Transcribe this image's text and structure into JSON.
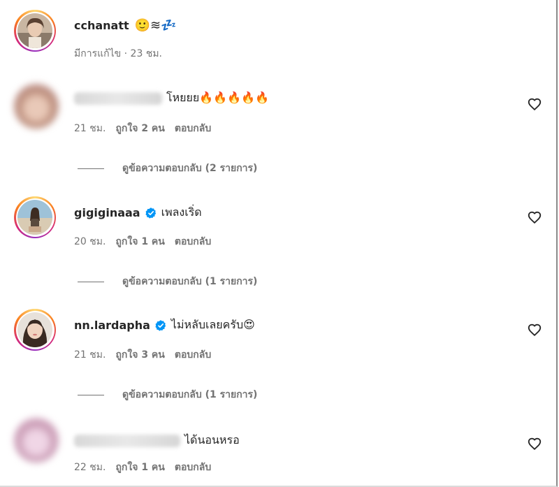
{
  "post": {
    "username": "cchanatt",
    "status_emoji": "🙂≋💤",
    "meta": "มีการแก้ไข · 23 ชม."
  },
  "comments": [
    {
      "username": "",
      "verified": false,
      "text": "โหยยย🔥🔥🔥🔥🔥",
      "time": "21 ชม.",
      "likes": "ถูกใจ 2 คน",
      "reply": "ตอบกลับ",
      "view_replies": "ดูข้อความตอบกลับ (2 รายการ)"
    },
    {
      "username": "gigiginaaa",
      "verified": true,
      "text": "เพลงเริ่ด",
      "time": "20 ชม.",
      "likes": "ถูกใจ 1 คน",
      "reply": "ตอบกลับ",
      "view_replies": "ดูข้อความตอบกลับ (1 รายการ)"
    },
    {
      "username": "nn.lardapha",
      "verified": true,
      "text": "ไม่หลับเลยครับ😍",
      "time": "21 ชม.",
      "likes": "ถูกใจ 3 คน",
      "reply": "ตอบกลับ",
      "view_replies": "ดูข้อความตอบกลับ (1 รายการ)"
    },
    {
      "username": "",
      "verified": false,
      "text": "ได้นอนหรอ",
      "time": "22 ชม.",
      "likes": "ถูกใจ 1 คน",
      "reply": "ตอบกลับ"
    }
  ],
  "icons": {
    "heart": "heart-outline-icon",
    "verified": "verified-badge-icon"
  },
  "colors": {
    "verified": "#0095f6",
    "text": "#262626",
    "secondary": "#737373"
  }
}
